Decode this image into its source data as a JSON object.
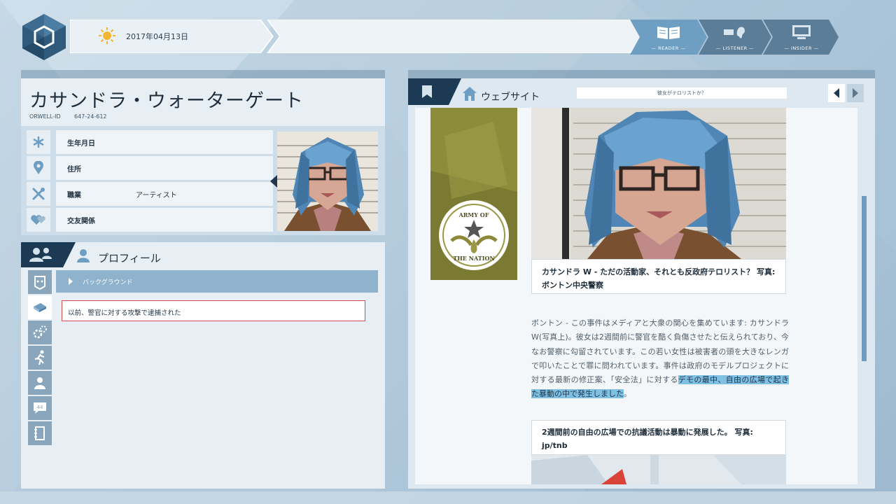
{
  "header": {
    "date": "2017年04月13日",
    "weather_icon": "sun-icon",
    "modes": [
      {
        "label": "— READER —",
        "icon": "book-icon",
        "active": true
      },
      {
        "label": "— LISTENER —",
        "icon": "ear-icon",
        "active": false
      },
      {
        "label": "— INSIDER —",
        "icon": "computer-icon",
        "active": false
      }
    ]
  },
  "profile": {
    "name": "カサンドラ・ウォーターゲート",
    "orwell_id_label": "ORWELL-ID",
    "orwell_id": "647-24-612",
    "fields": [
      {
        "icon": "asterisk-icon",
        "label": "生年月日",
        "value": ""
      },
      {
        "icon": "location-pin-icon",
        "label": "住所",
        "value": ""
      },
      {
        "icon": "tools-icon",
        "label": "職業",
        "value": "アーティスト"
      },
      {
        "icon": "hearts-icon",
        "label": "交友関係",
        "value": ""
      }
    ],
    "section_title": "プロフィール",
    "category_label": "バックグラウンド",
    "facts": [
      "以前、警官に対する攻撃で逮捕された"
    ],
    "sidebar_icons": [
      "face-icon",
      "book-icon",
      "gears-icon",
      "running-person-icon",
      "person-icon",
      "speech-bubble-icon",
      "notebook-icon"
    ]
  },
  "website": {
    "title": "ウェブサイト",
    "url": "彼女がテロリストか？",
    "ad_text_top": "ARMY OF",
    "ad_text_bottom": "THE NATION",
    "caption1": "カサンドラ W - ただの活動家、それとも反政府テロリスト？ 写真: ボントン中央警察",
    "article_plain": "ボントン - この事件はメディアと大衆の関心を集めています: カサンドラW(写真上)。彼女は2週間前に警官を酷く負傷させたと伝えられており、今なお警察に勾留されています。この若い女性は被害者の頭を大きなレンガで叩いたことで罪に問われています。事件は政府のモデルプロジェクトに対する最新の修正案、「安全法」に対する",
    "article_highlight": "デモの最中、自由の広場で起きた暴動の中で発生しました",
    "article_end": "。",
    "caption2": "2週間前の自由の広場での抗議活動は暴動に発展した。 写真: jp/tnb"
  },
  "colors": {
    "accent_dark": "#1d3a55",
    "highlight": "#7fc1e5",
    "fact_border": "#d44c47",
    "scrollbar": "#6b9dc4"
  }
}
